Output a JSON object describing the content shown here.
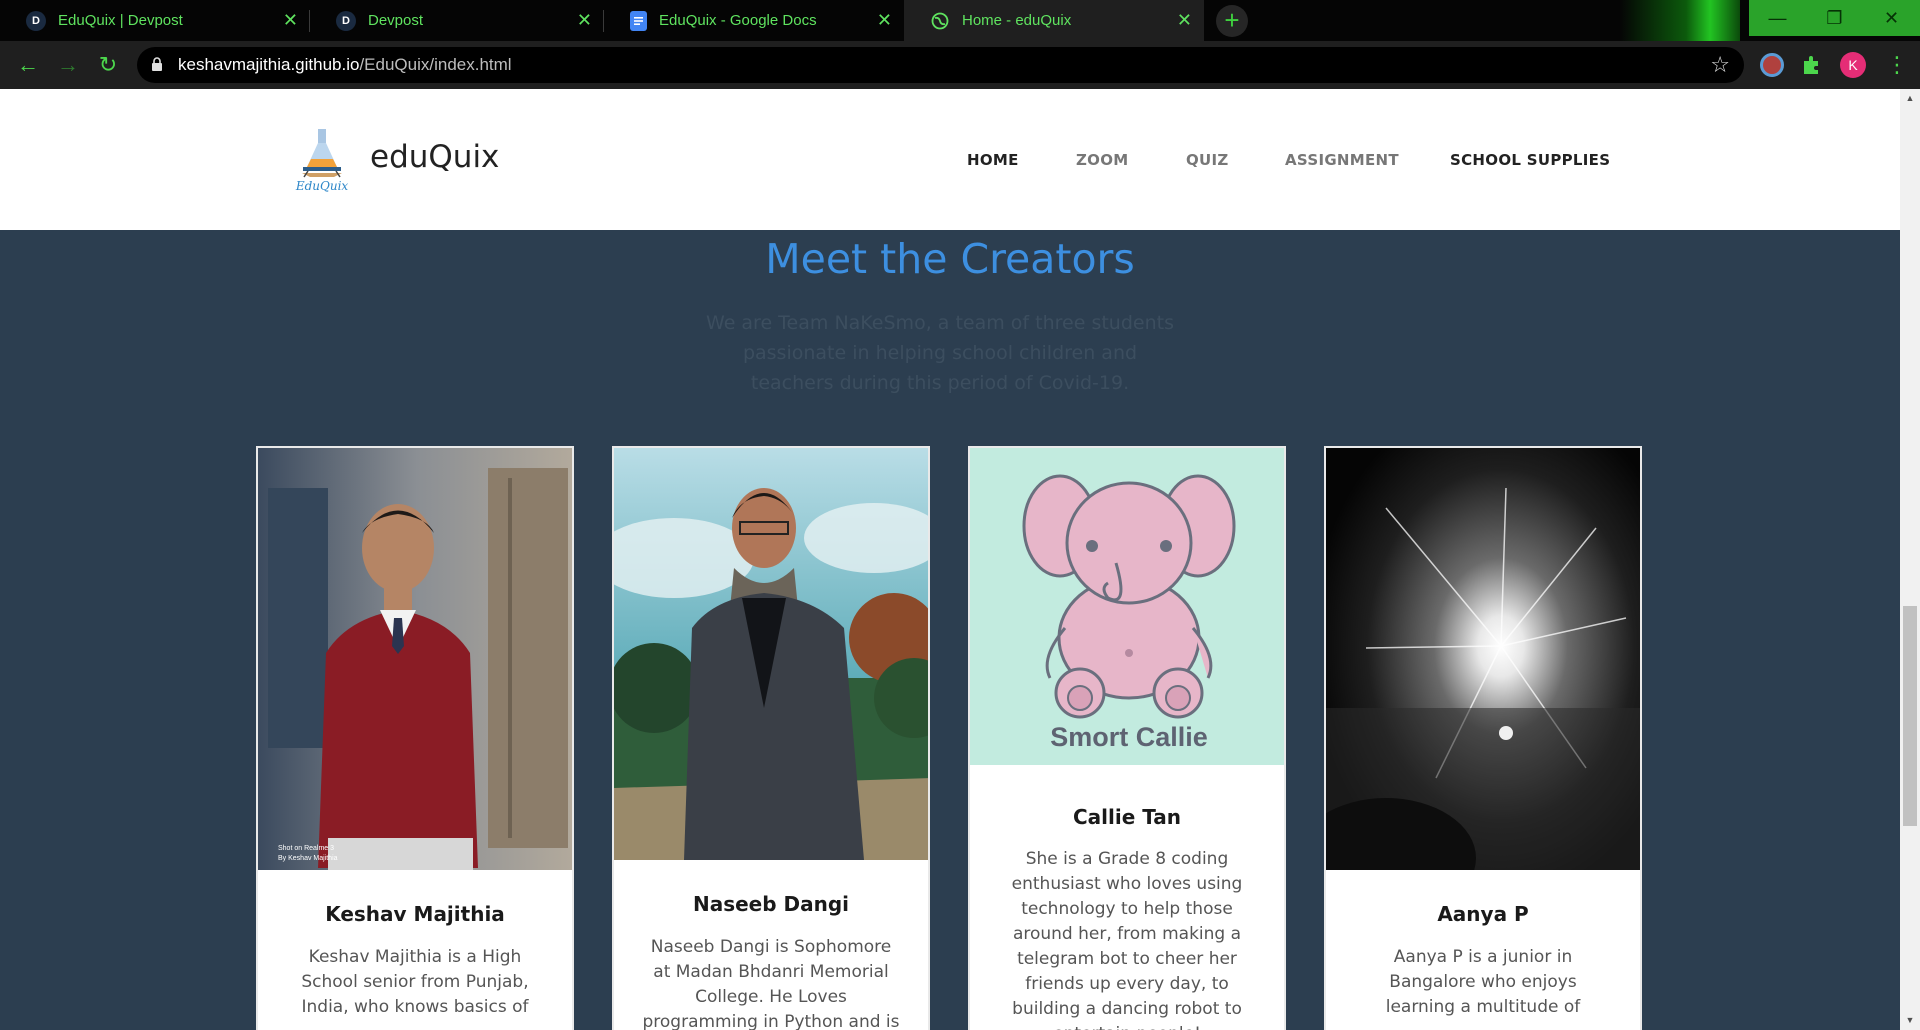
{
  "browser": {
    "tabs": [
      {
        "title": "EduQuix | Devpost",
        "favicon": "D",
        "favicon_color": "#1a2a40"
      },
      {
        "title": "Devpost",
        "favicon": "D",
        "favicon_color": "#1a2a40"
      },
      {
        "title": "EduQuix - Google Docs",
        "favicon": "docs-icon",
        "favicon_color": "#4285f4"
      },
      {
        "title": "Home - eduQuix",
        "favicon": "globe-icon",
        "favicon_color": "#5fe35f"
      }
    ],
    "url_host": "keshavmajithia.github.io",
    "url_path": "/EduQuix/index.html",
    "profile_initial": "K",
    "accent_color": "#5fe35f"
  },
  "site": {
    "brand": "eduQuix",
    "logo_text": "EduQuix",
    "nav": [
      "HOME",
      "ZOOM",
      "QUIZ",
      "ASSIGNMENT",
      "SCHOOL SUPPLIES"
    ]
  },
  "section": {
    "title": "Meet the Creators",
    "subtitle": "We are Team NaKeSmo, a team of three students passionate in helping school children and teachers during this period of Covid-19."
  },
  "creators": [
    {
      "name": "Keshav Majithia",
      "bio": "Keshav Majithia is a High School senior from Punjab, India, who knows basics of",
      "photo_caption": "Shot on Realme 3\nBy Keshav Majithia"
    },
    {
      "name": "Naseeb Dangi",
      "bio": "Naseeb Dangi is Sophomore at Madan Bhdanri Memorial College. He Loves programming in Python and is"
    },
    {
      "name": "Callie Tan",
      "bio": "She is a Grade 8 coding enthusiast who loves using technology to help those around her, from making a telegram bot to cheer her friends up every day, to building a dancing robot to entertain people!",
      "photo_text": "Smort Callie"
    },
    {
      "name": "Aanya P",
      "bio": "Aanya P is a junior in Bangalore who enjoys learning a multitude of"
    }
  ]
}
